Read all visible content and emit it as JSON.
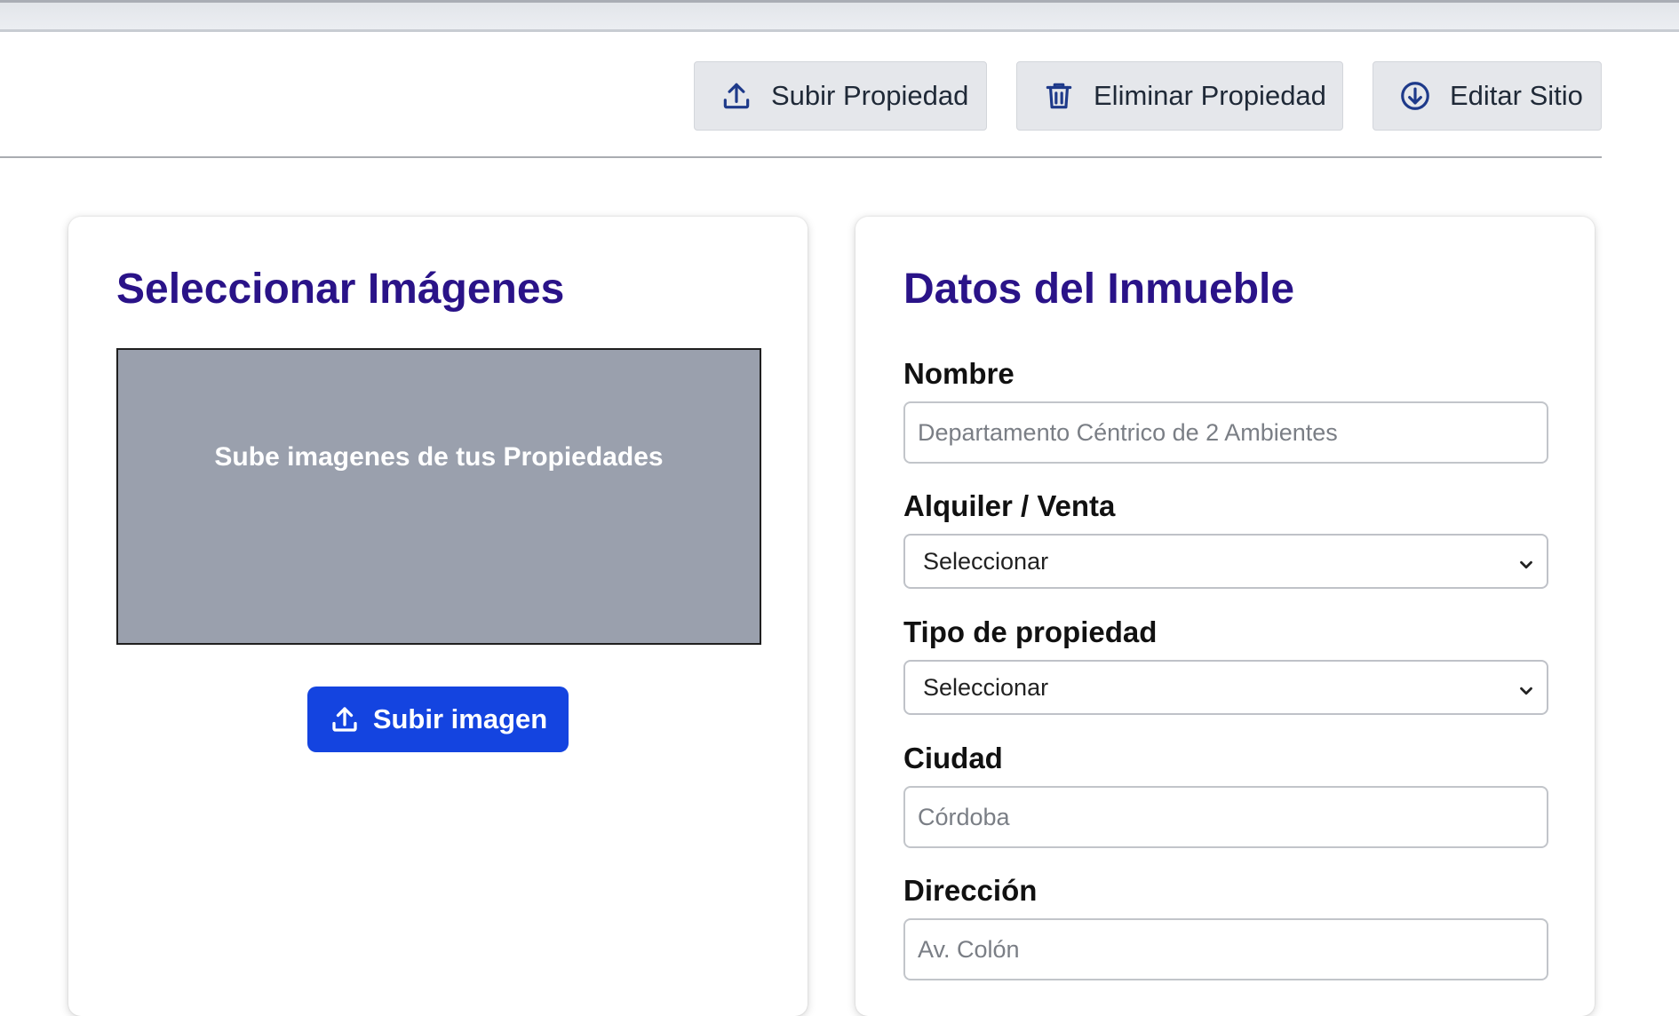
{
  "toolbar": {
    "upload_property": "Subir Propiedad",
    "delete_property": "Eliminar Propiedad",
    "edit_site": "Editar Sitio"
  },
  "images_card": {
    "title": "Seleccionar Imágenes",
    "dropzone_text": "Sube imagenes de tus Propiedades",
    "upload_button": "Subir imagen"
  },
  "property_card": {
    "title": "Datos del Inmueble",
    "fields": {
      "name": {
        "label": "Nombre",
        "placeholder": "Departamento Céntrico de 2 Ambientes"
      },
      "operation": {
        "label": "Alquiler / Venta",
        "selected": "Seleccionar"
      },
      "type": {
        "label": "Tipo de propiedad",
        "selected": "Seleccionar"
      },
      "city": {
        "label": "Ciudad",
        "placeholder": "Córdoba"
      },
      "address": {
        "label": "Dirección",
        "placeholder": "Av. Colón"
      }
    }
  },
  "icons": {
    "upload": "upload-icon",
    "trash": "trash-icon",
    "download_circle": "arrow-down-circle-icon",
    "chevron": "chevron-down-icon"
  },
  "colors": {
    "title": "#2a1388",
    "primary_button": "#1444e0",
    "dropzone": "#9aa0ad",
    "toolbar_button": "#e5e7eb"
  }
}
